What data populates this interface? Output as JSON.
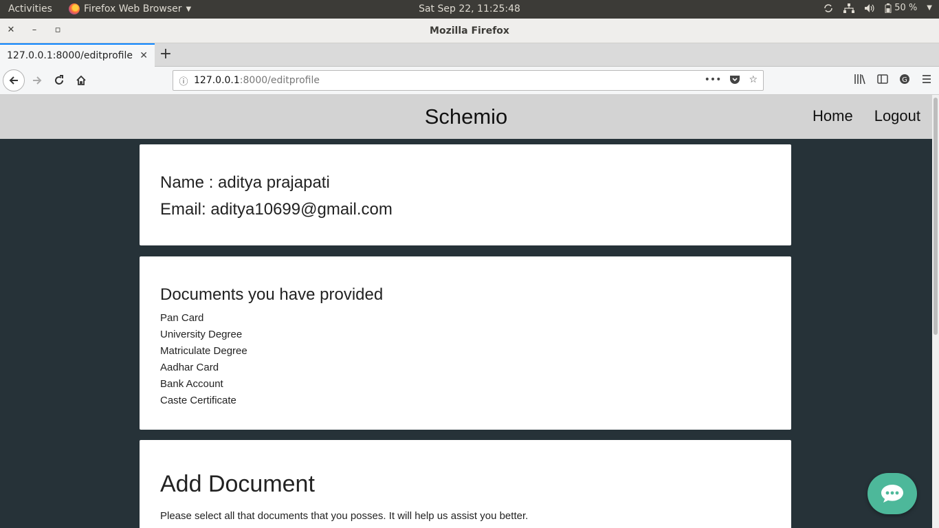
{
  "os_bar": {
    "activities": "Activities",
    "app_name": "Firefox Web Browser",
    "clock": "Sat Sep 22, 11:25:48",
    "battery": "50 %"
  },
  "window": {
    "title": "Mozilla Firefox"
  },
  "browser": {
    "tab_title": "127.0.0.1:8000/editprofile",
    "url_host": "127.0.0.1",
    "url_path": ":8000/editprofile"
  },
  "site": {
    "brand": "Schemio",
    "nav": [
      {
        "label": "Home"
      },
      {
        "label": "Logout"
      }
    ]
  },
  "profile": {
    "name_line": "Name : aditya prajapati",
    "email_line": "Email: aditya10699@gmail.com"
  },
  "documents": {
    "heading": "Documents you have provided",
    "items": [
      "Pan Card",
      "University Degree",
      "Matriculate Degree",
      "Aadhar Card",
      "Bank Account",
      "Caste Certificate"
    ]
  },
  "add_document": {
    "heading": "Add Document",
    "description": "Please select all that documents that you posses. It will help us assist you better."
  },
  "colors": {
    "page_bg": "#263238",
    "header_bg": "#d3d3d3",
    "chat_fab": "#4db89a"
  },
  "icons": {
    "chat": "chat-bubble-icon"
  }
}
